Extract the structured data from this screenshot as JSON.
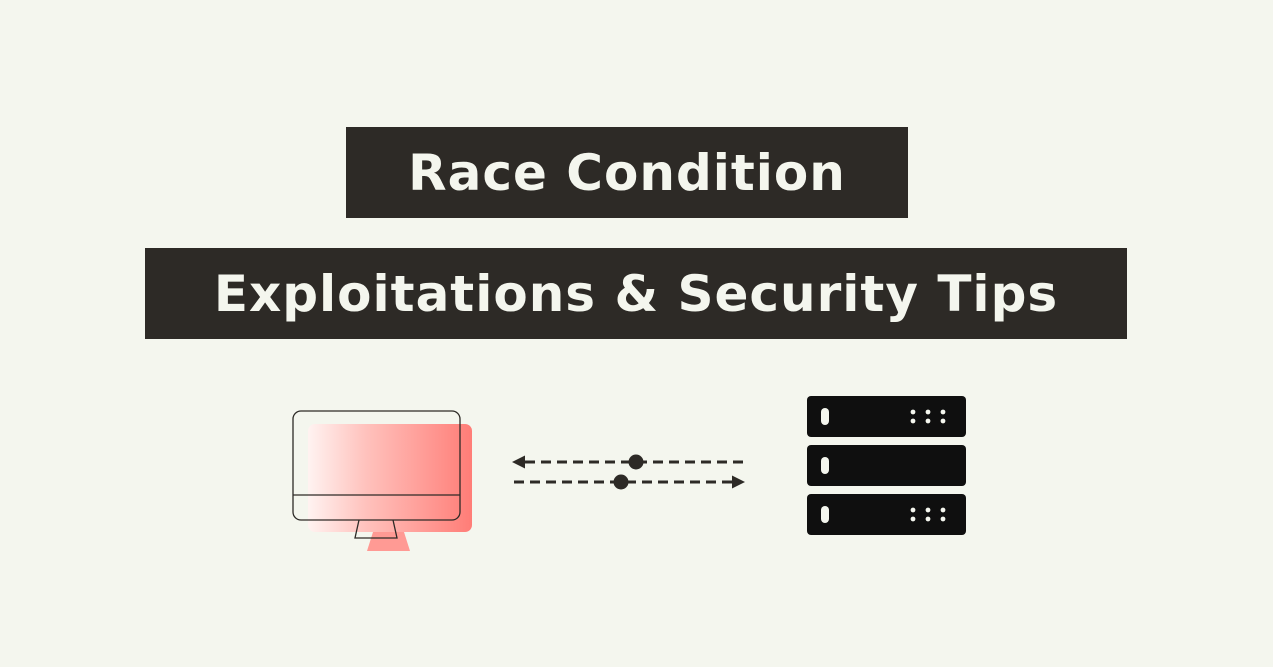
{
  "title": {
    "line1": "Race Condition",
    "line2": "Exploitations & Security Tips"
  },
  "illustration": {
    "left_icon": "monitor-icon",
    "center_icon": "bidirectional-arrows-icon",
    "right_icon": "server-rack-icon",
    "colors": {
      "background": "#f4f6ee",
      "title_bar": "#2d2a26",
      "title_text": "#f4f6ee",
      "monitor_gradient_start": "#fde7e5",
      "monitor_gradient_end": "#ff7d77",
      "server": "#0f0f0f",
      "arrows": "#2d2a26"
    }
  }
}
